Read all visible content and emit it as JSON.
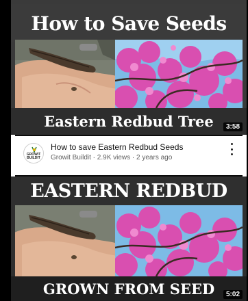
{
  "video1": {
    "thumbnail_title": "How to Save Seeds",
    "thumbnail_subtitle": "Eastern Redbud Tree",
    "duration": "3:58",
    "title": "How to save Eastern Redbud Seeds",
    "meta": "Growit Buildit · 2.9K views · 2 years ago",
    "channel_avatar_text": "GROWIT BUILDIT"
  },
  "video2": {
    "thumbnail_title": "EASTERN REDBUD",
    "thumbnail_subtitle": "GROWN FROM SEED",
    "duration": "5:02"
  },
  "icons": {
    "menu": "kebab-menu-icon",
    "avatar": "channel-avatar-icon"
  },
  "colors": {
    "title_bar": "#3b3b3b",
    "subtitle_bar": "#2d2d2d",
    "text": "#ffffff",
    "meta_text": "#606060",
    "blossom": "#d94fb0"
  }
}
